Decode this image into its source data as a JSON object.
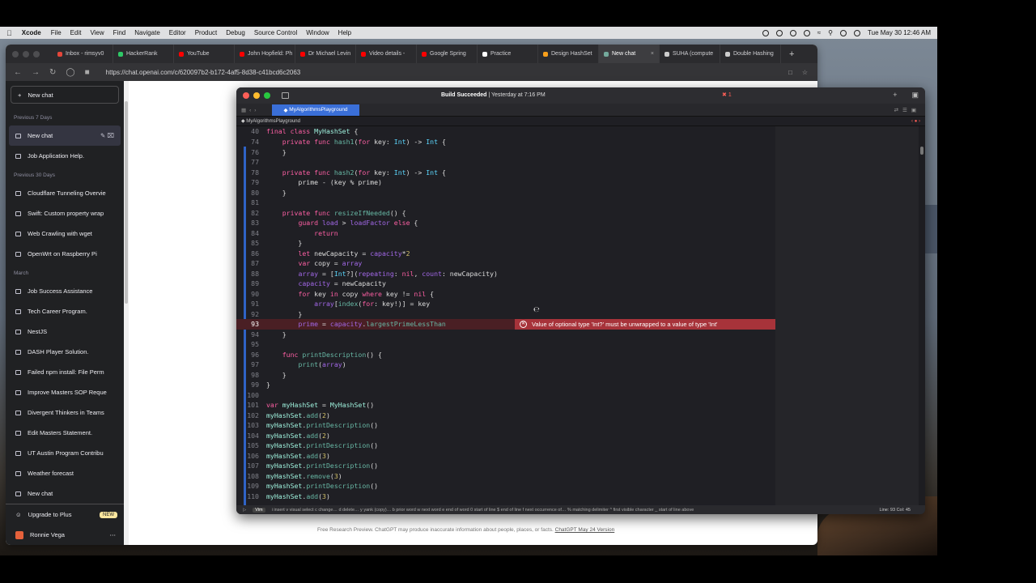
{
  "menubar": {
    "app": "Xcode",
    "items": [
      "File",
      "Edit",
      "View",
      "Find",
      "Navigate",
      "Editor",
      "Product",
      "Debug",
      "Source Control",
      "Window",
      "Help"
    ],
    "clock": "Tue May 30  12:46 AM"
  },
  "browser": {
    "tabs": [
      {
        "label": "Inbox - rimsyv0",
        "color": "#e4463a"
      },
      {
        "label": "HackerRank",
        "color": "#2ec866"
      },
      {
        "label": "YouTube",
        "color": "#ff0000"
      },
      {
        "label": "John Hopfield: Ph",
        "color": "#ff0000"
      },
      {
        "label": "Dr Michael Levin",
        "color": "#ff0000"
      },
      {
        "label": "Video details - ",
        "color": "#ff0000"
      },
      {
        "label": "Google Spring ",
        "color": "#ff0000"
      },
      {
        "label": "Practice",
        "color": "#ffffff"
      },
      {
        "label": "Design HashSet",
        "color": "#f89f1b"
      },
      {
        "label": "New chat",
        "color": "#74aa9c"
      },
      {
        "label": "SUHA (compute",
        "color": "#cccccc"
      },
      {
        "label": "Double Hashing",
        "color": "#cccccc"
      }
    ],
    "url": "https://chat.openai.com/c/620097b2-b172-4af5-8d38-c41bcd6c2063"
  },
  "chatgpt": {
    "new_chat": "New chat",
    "sections": [
      {
        "title": "Previous 7 Days",
        "items": [
          "New chat",
          "Job Application Help."
        ]
      },
      {
        "title": "Previous 30 Days",
        "items": [
          "Cloudflare Tunneling Overvie",
          "Swift: Custom property wrap",
          "Web Crawling with wget",
          "OpenWrt on Raspberry Pi"
        ]
      },
      {
        "title": "March",
        "items": [
          "Job Success Assistance",
          "Tech Career Program.",
          "NestJS",
          "DASH Player Solution.",
          "Failed npm install: File Perm",
          "Improve Masters SOP Reque",
          "Divergent Thinkers in Teams",
          "Edit Masters Statement.",
          "UT Austin Program Contribu",
          "Weather forecast",
          "New chat"
        ]
      }
    ],
    "upgrade": "Upgrade to Plus",
    "new_badge": "NEW",
    "user": "Ronnie Vega",
    "footer_text": "Free Research Preview. ChatGPT may produce inaccurate information about people, places, or facts.",
    "footer_link": "ChatGPT May 24 Version"
  },
  "xcode": {
    "status_bold": "Build Succeeded",
    "status_rest": " | Yesterday at 7:16 PM",
    "error_count": "1",
    "file_tab": "MyAlgorithmsPlayground",
    "jump_bar": "MyAlgorithmsPlayground",
    "error_message": "Value of optional type 'Int?' must be unwrapped to a value of type 'Int'",
    "status_hints": "i insert  v visual select  c change…  d delete…  y yank (copy)…  b prior word  w next word  e end of word  0 start of line  $ end of line  f next occurrence of…  % matching delimiter  ^ first visible character  _ start of line above",
    "vim_label": "Vim",
    "cursor_pos": "Line: 93  Col: 45",
    "lines": [
      {
        "n": "40",
        "html": "<span class=\"kw\">final class</span> <span class=\"cl\">MyHashSet</span> {"
      },
      {
        "n": "74",
        "html": "    <span class=\"kw\">private func</span> <span class=\"fn\">hash1</span>(<span class=\"kw\">for</span> key: <span class=\"ty\">Int</span>) -> <span class=\"ty\">Int</span> {"
      },
      {
        "n": "76",
        "html": "    }"
      },
      {
        "n": "77",
        "html": ""
      },
      {
        "n": "78",
        "html": "    <span class=\"kw\">private func</span> <span class=\"fn\">hash2</span>(<span class=\"kw\">for</span> key: <span class=\"ty\">Int</span>) -> <span class=\"ty\">Int</span> {"
      },
      {
        "n": "79",
        "html": "        prime - (key % prime)"
      },
      {
        "n": "80",
        "html": "    }"
      },
      {
        "n": "81",
        "html": ""
      },
      {
        "n": "82",
        "html": "    <span class=\"kw\">private func</span> <span class=\"fn\">resizeIfNeeded</span>() {"
      },
      {
        "n": "83",
        "html": "        <span class=\"kw\">guard</span> <span class=\"pa\">load</span> > <span class=\"pa\">loadFactor</span> <span class=\"kw\">else</span> {"
      },
      {
        "n": "84",
        "html": "            <span class=\"kw\">return</span>"
      },
      {
        "n": "85",
        "html": "        }"
      },
      {
        "n": "86",
        "html": "        <span class=\"kw\">let</span> newCapacity = <span class=\"pa\">capacity</span>*<span class=\"nu\">2</span>"
      },
      {
        "n": "87",
        "html": "        <span class=\"kw\">var</span> copy = <span class=\"pa\">array</span>"
      },
      {
        "n": "88",
        "html": "        <span class=\"pa\">array</span> = [<span class=\"ty\">Int</span>?](<span class=\"pa\">repeating</span>: <span class=\"kw\">nil</span>, <span class=\"pa\">count</span>: newCapacity)"
      },
      {
        "n": "89",
        "html": "        <span class=\"pa\">capacity</span> = newCapacity"
      },
      {
        "n": "90",
        "html": "        <span class=\"kw\">for</span> key <span class=\"kw\">in</span> copy <span class=\"kw\">where</span> key != <span class=\"kw\">nil</span> {"
      },
      {
        "n": "91",
        "html": "            <span class=\"pa\">array</span>[<span class=\"fn\">index</span>(<span class=\"kw\">for</span>: key!)] = key"
      },
      {
        "n": "92",
        "html": "        }"
      },
      {
        "n": "93",
        "html": "        <span class=\"pa\">prime</span> = <span class=\"pa\">capacity</span>.<span class=\"fn\">largestPrimeLessThan</span>",
        "err": true
      },
      {
        "n": "94",
        "html": "    }"
      },
      {
        "n": "95",
        "html": ""
      },
      {
        "n": "96",
        "html": "    <span class=\"kw\">func</span> <span class=\"fn\">printDescription</span>() {"
      },
      {
        "n": "97",
        "html": "        <span class=\"fn\">print</span>(<span class=\"pa\">array</span>)"
      },
      {
        "n": "98",
        "html": "    }"
      },
      {
        "n": "99",
        "html": "}"
      },
      {
        "n": "100",
        "html": ""
      },
      {
        "n": "101",
        "html": "<span class=\"kw\">var</span> <span class=\"cl\">myHashSet</span> = <span class=\"cl\">MyHashSet</span>()"
      },
      {
        "n": "102",
        "html": "<span class=\"cl\">myHashSet</span>.<span class=\"fn\">add</span>(<span class=\"nu\">2</span>)"
      },
      {
        "n": "103",
        "html": "<span class=\"cl\">myHashSet</span>.<span class=\"fn\">printDescription</span>()"
      },
      {
        "n": "104",
        "html": "<span class=\"cl\">myHashSet</span>.<span class=\"fn\">add</span>(<span class=\"nu\">2</span>)"
      },
      {
        "n": "105",
        "html": "<span class=\"cl\">myHashSet</span>.<span class=\"fn\">printDescription</span>()"
      },
      {
        "n": "106",
        "html": "<span class=\"cl\">myHashSet</span>.<span class=\"fn\">add</span>(<span class=\"nu\">3</span>)"
      },
      {
        "n": "107",
        "html": "<span class=\"cl\">myHashSet</span>.<span class=\"fn\">printDescription</span>()"
      },
      {
        "n": "108",
        "html": "<span class=\"cl\">myHashSet</span>.<span class=\"fn\">remove</span>(<span class=\"nu\">3</span>)"
      },
      {
        "n": "109",
        "html": "<span class=\"cl\">myHashSet</span>.<span class=\"fn\">printDescription</span>()"
      },
      {
        "n": "110",
        "html": "<span class=\"cl\">myHashSet</span>.<span class=\"fn\">add</span>(<span class=\"nu\">3</span>)"
      }
    ]
  }
}
